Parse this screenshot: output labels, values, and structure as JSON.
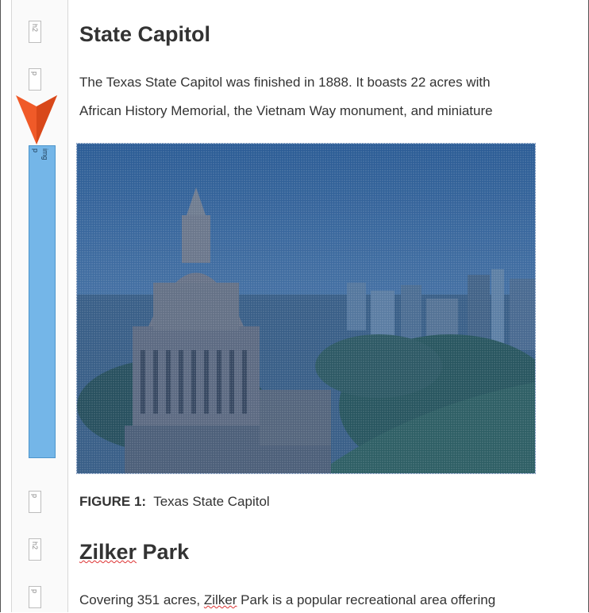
{
  "gutter": {
    "tags": [
      "h2",
      "p",
      "p",
      "h2",
      "p"
    ],
    "active_tags": [
      "p",
      "img"
    ]
  },
  "sections": {
    "s1_title": "State Capitol",
    "s1_line1": "The Texas State Capitol was finished in 1888. It boasts 22 acres with",
    "s1_line2": "African History Memorial, the Vietnam Way monument, and miniature",
    "figure_label": "FIGURE 1:",
    "figure_text": "Texas State Capitol",
    "s2_title_pre": "",
    "s2_title_word1": "Zilker",
    "s2_title_word2": " Park",
    "s3_text_pre": "Covering 351 acres, ",
    "s3_text_err": "Zilker",
    "s3_text_post": " Park is a popular recreational area offering"
  },
  "colors": {
    "accent_arrow": "#f05a28",
    "selection": "#74b6e8",
    "overlay": "#1f4f8a"
  }
}
